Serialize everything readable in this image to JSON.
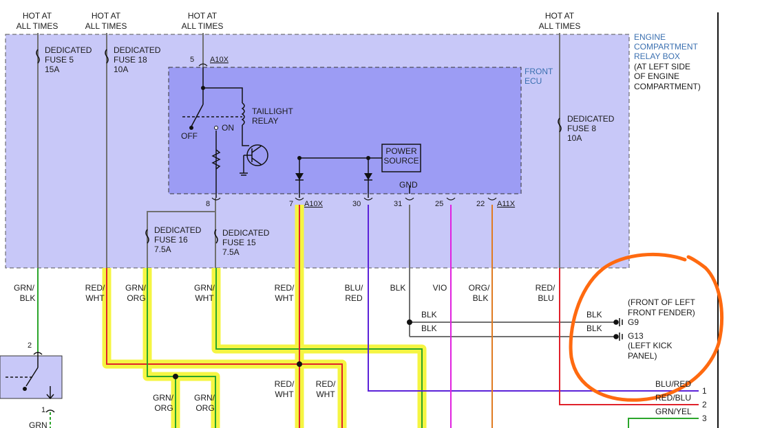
{
  "hot_labels": {
    "col1": [
      "HOT AT",
      "ALL TIMES"
    ],
    "col2": [
      "HOT AT",
      "ALL TIMES"
    ],
    "col3": [
      "HOT AT",
      "ALL TIMES"
    ],
    "col4": [
      "HOT AT",
      "ALL TIMES"
    ]
  },
  "relay_box": {
    "title_lines": [
      "ENGINE",
      "COMPARTMENT",
      "RELAY BOX"
    ],
    "location_lines": [
      "(AT LEFT SIDE",
      "OF ENGINE",
      "COMPARTMENT)"
    ]
  },
  "fuses": {
    "f5": [
      "DEDICATED",
      "FUSE 5",
      "15A"
    ],
    "f18": [
      "DEDICATED",
      "FUSE 18",
      "10A"
    ],
    "f8": [
      "DEDICATED",
      "FUSE 8",
      "10A"
    ],
    "f16": [
      "DEDICATED",
      "FUSE 16",
      "7.5A"
    ],
    "f15": [
      "DEDICATED",
      "FUSE 15",
      "7.5A"
    ]
  },
  "ecu": {
    "title_lines": [
      "FRONT",
      "ECU"
    ],
    "relay_lines": [
      "TAILLIGHT",
      "RELAY"
    ],
    "switch_off": "OFF",
    "switch_on": "ON",
    "power_source": [
      "POWER",
      "SOURCE"
    ],
    "gnd": "GND"
  },
  "connectors": {
    "top_pin": "5",
    "top_conn": "A10X",
    "pins": [
      "8",
      "7",
      "30",
      "31",
      "25",
      "22"
    ],
    "conn_a10x": "A10X",
    "conn_a11x": "A11X"
  },
  "wires": {
    "w1": [
      "GRN/",
      "BLK"
    ],
    "w2": [
      "RED/",
      "WHT"
    ],
    "w3": [
      "GRN/",
      "ORG"
    ],
    "w4": [
      "GRN/",
      "WHT"
    ],
    "w5": [
      "RED/",
      "WHT"
    ],
    "w6": [
      "BLU/",
      "RED"
    ],
    "w7": "BLK",
    "w8": "VIO",
    "w9": [
      "ORG/",
      "BLK"
    ],
    "w10": [
      "RED/",
      "BLU"
    ],
    "blk1": "BLK",
    "blk2": "BLK",
    "blk3": "BLK",
    "blk4": "BLK",
    "lower_grn_org_a": [
      "GRN/",
      "ORG"
    ],
    "lower_grn_org_b": [
      "GRN/",
      "ORG"
    ],
    "lower_red_wht_a": [
      "RED/",
      "WHT"
    ],
    "lower_red_wht_b": [
      "RED/",
      "WHT"
    ],
    "bottom_left": "GRN",
    "out_blu_red": "BLU/RED",
    "out_red_blu": "RED/BLU",
    "out_grn_yel": "GRN/YEL"
  },
  "grounds": {
    "g9_desc": [
      "(FRONT OF LEFT",
      "FRONT FENDER)"
    ],
    "g9": "G9",
    "g13": "G13",
    "g13_desc": [
      "(LEFT KICK",
      "PANEL)"
    ]
  },
  "pins_right": [
    "1",
    "2",
    "3"
  ],
  "switch_pins": [
    "2",
    "1"
  ],
  "colors": {
    "relay_box_fill": "#c8c8f8",
    "ecu_fill": "#9c9cf4",
    "highlight": "#f5f542",
    "annotation": "#ff6a10",
    "wire_green": "#2aa52a",
    "wire_red": "#e0202a",
    "wire_blue": "#5a20d8",
    "wire_violet": "#e020e0",
    "wire_orange": "#e07a20",
    "wire_gray": "#707070"
  }
}
